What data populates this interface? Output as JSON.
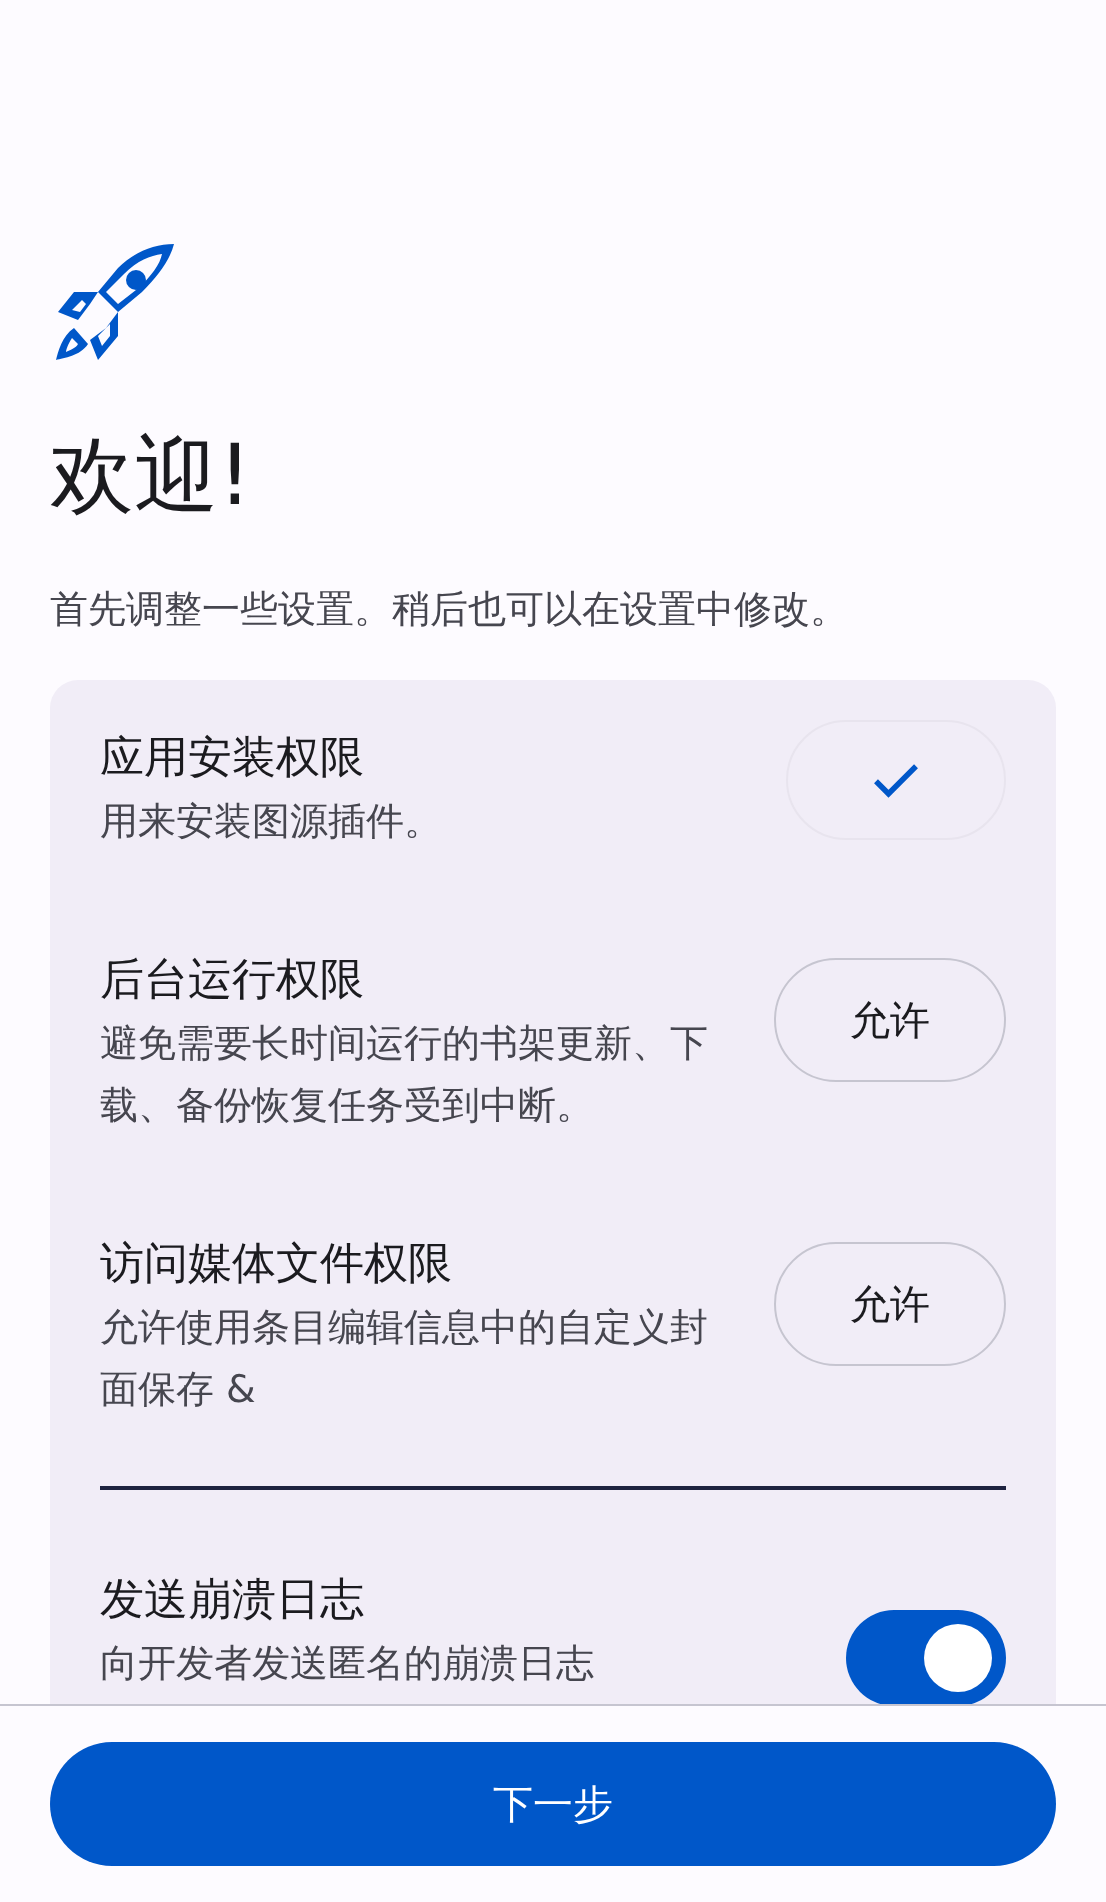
{
  "header": {
    "title": "欢迎!",
    "subtitle": "首先调整一些设置。稍后也可以在设置中修改。"
  },
  "settings": [
    {
      "kind": "permission",
      "title": "应用安装权限",
      "description": "用来安装图源插件。",
      "granted": true
    },
    {
      "kind": "permission",
      "title": "后台运行权限",
      "description": "避免需要长时间运行的书架更新、下载、备份恢复任务受到中断。",
      "granted": false,
      "button_label": "允许"
    },
    {
      "kind": "permission",
      "title": "访问媒体文件权限",
      "description": "允许使用条目编辑信息中的自定义封面保存 &",
      "granted": false,
      "button_label": "允许"
    },
    {
      "kind": "divider"
    },
    {
      "kind": "toggle",
      "title": "发送崩溃日志",
      "description": "向开发者发送匿名的崩溃日志",
      "on": true
    }
  ],
  "next_button": "下一步"
}
